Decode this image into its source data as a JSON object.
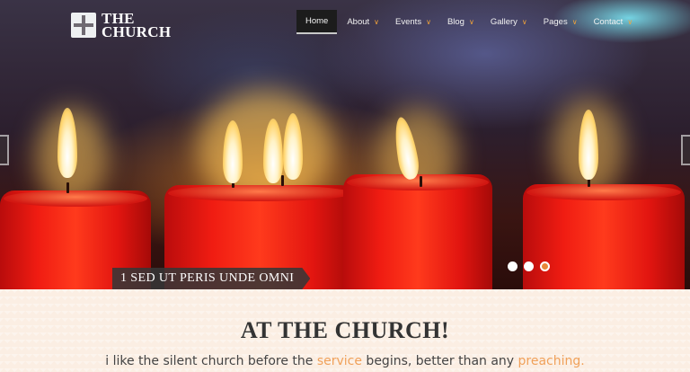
{
  "brand": {
    "line1": "THE",
    "line2": "CHURCH"
  },
  "nav": {
    "home": "Home",
    "about": "About",
    "events": "Events",
    "blog": "Blog",
    "gallery": "Gallery",
    "pages": "Pages",
    "contact": "Contact",
    "chevron": "∨"
  },
  "slider": {
    "caption": "1 SED UT PERIS UNDE OMNI",
    "slide_count": 3,
    "active_slide": 3
  },
  "intro": {
    "heading": "AT THE CHURCH!",
    "text_a": "i like the silent church before the ",
    "link_service": "service",
    "text_b": " begins, better than any ",
    "link_preaching": "preaching."
  },
  "colors": {
    "accent": "#e8873a",
    "link": "#f0a15a",
    "nav_active_bg": "#1c1c1c"
  },
  "icons": {
    "logo": "cross-icon",
    "prev": "arrow-left-icon",
    "next": "arrow-right-icon"
  }
}
